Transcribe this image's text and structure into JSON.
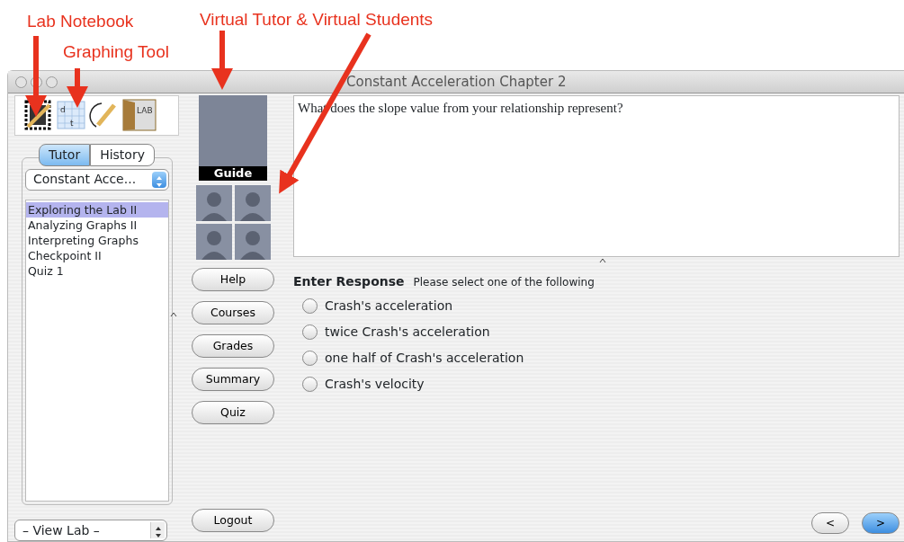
{
  "annotations": [
    {
      "text": "Lab Notebook"
    },
    {
      "text": "Graphing Tool"
    },
    {
      "text": "Virtual Tutor & Virtual Students"
    }
  ],
  "window": {
    "title": "Constant Acceleration Chapter 2"
  },
  "toolbar": {
    "graph_axes": [
      "d",
      "t"
    ],
    "door_sign": "LAB"
  },
  "tabs": [
    {
      "label": "Tutor",
      "selected": true
    },
    {
      "label": "History",
      "selected": false
    }
  ],
  "chapter_select": {
    "value": "Constant Acce..."
  },
  "lessons": [
    {
      "label": "Exploring the Lab II",
      "selected": true
    },
    {
      "label": "Analyzing Graphs II",
      "selected": false
    },
    {
      "label": "Interpreting Graphs",
      "selected": false
    },
    {
      "label": "Checkpoint II",
      "selected": false
    },
    {
      "label": "Quiz 1",
      "selected": false
    }
  ],
  "lab_select": {
    "value": "– View Lab –"
  },
  "guide": {
    "caption": "Guide"
  },
  "buttons": [
    "Help",
    "Courses",
    "Grades",
    "Summary",
    "Quiz"
  ],
  "logout": "Logout",
  "question": "What does the slope value from your relationship represent?",
  "response": {
    "title": "Enter Response",
    "hint": "Please select one of the following",
    "options": [
      {
        "label": "Crash's acceleration",
        "selected": false
      },
      {
        "label": "twice Crash's acceleration",
        "selected": false
      },
      {
        "label": "one half of Crash's acceleration",
        "selected": false
      },
      {
        "label": "Crash's velocity",
        "selected": false
      }
    ]
  },
  "nav": [
    {
      "label": "<",
      "default": false
    },
    {
      "label": ">",
      "default": true
    }
  ]
}
